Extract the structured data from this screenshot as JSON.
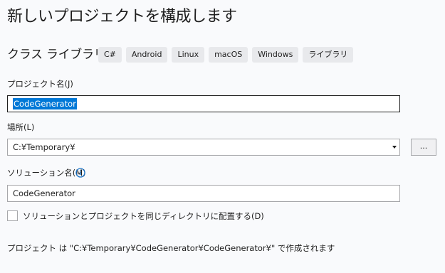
{
  "page_title": "新しいプロジェクトを構成します",
  "template": {
    "name": "クラス ライブラリ",
    "tags": [
      "C#",
      "Android",
      "Linux",
      "macOS",
      "Windows",
      "ライブラリ"
    ]
  },
  "project_name": {
    "label": "プロジェクト名(J)",
    "value": "CodeGenerator"
  },
  "location": {
    "label": "場所(L)",
    "value": "C:¥Temporary¥",
    "browse_label": "..."
  },
  "solution_name": {
    "label": "ソリューション名(M)",
    "value": "CodeGenerator",
    "info_icon": "info-circle-icon"
  },
  "same_directory": {
    "label": "ソリューションとプロジェクトを同じディレクトリに配置する(D)",
    "checked": false
  },
  "footer_text": "プロジェクト は \"C:¥Temporary¥CodeGenerator¥CodeGenerator¥\" で作成されます",
  "colors": {
    "background": "#f9fafc",
    "selection": "#0078d7",
    "info_icon": "#1a73c6",
    "tag_background": "#e8e9ec"
  }
}
